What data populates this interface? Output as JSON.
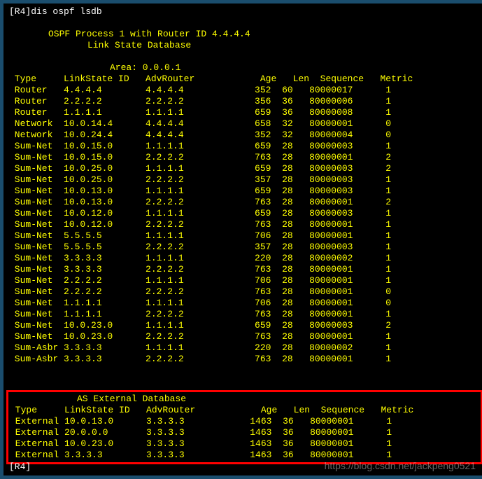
{
  "prompt_prefix": "[R4]",
  "command": "dis ospf lsdb",
  "header1": "OSPF Process 1 with Router ID 4.4.4.4",
  "header2": "Link State Database",
  "area_label": "Area: 0.0.0.1",
  "cols": {
    "type": "Type",
    "lsid": "LinkState ID",
    "advrouter": "AdvRouter",
    "age": "Age",
    "len": "Len",
    "seq": "Sequence",
    "metric": "Metric"
  },
  "lsdb_rows": [
    {
      "type": "Router",
      "lsid": "4.4.4.4",
      "adv": "4.4.4.4",
      "age": "352",
      "len": "60",
      "seq": "80000017",
      "metric": "1"
    },
    {
      "type": "Router",
      "lsid": "2.2.2.2",
      "adv": "2.2.2.2",
      "age": "356",
      "len": "36",
      "seq": "80000006",
      "metric": "1"
    },
    {
      "type": "Router",
      "lsid": "1.1.1.1",
      "adv": "1.1.1.1",
      "age": "659",
      "len": "36",
      "seq": "80000008",
      "metric": "1"
    },
    {
      "type": "Network",
      "lsid": "10.0.14.4",
      "adv": "4.4.4.4",
      "age": "658",
      "len": "32",
      "seq": "80000001",
      "metric": "0"
    },
    {
      "type": "Network",
      "lsid": "10.0.24.4",
      "adv": "4.4.4.4",
      "age": "352",
      "len": "32",
      "seq": "80000004",
      "metric": "0"
    },
    {
      "type": "Sum-Net",
      "lsid": "10.0.15.0",
      "adv": "1.1.1.1",
      "age": "659",
      "len": "28",
      "seq": "80000003",
      "metric": "1"
    },
    {
      "type": "Sum-Net",
      "lsid": "10.0.15.0",
      "adv": "2.2.2.2",
      "age": "763",
      "len": "28",
      "seq": "80000001",
      "metric": "2"
    },
    {
      "type": "Sum-Net",
      "lsid": "10.0.25.0",
      "adv": "1.1.1.1",
      "age": "659",
      "len": "28",
      "seq": "80000003",
      "metric": "2"
    },
    {
      "type": "Sum-Net",
      "lsid": "10.0.25.0",
      "adv": "2.2.2.2",
      "age": "357",
      "len": "28",
      "seq": "80000003",
      "metric": "1"
    },
    {
      "type": "Sum-Net",
      "lsid": "10.0.13.0",
      "adv": "1.1.1.1",
      "age": "659",
      "len": "28",
      "seq": "80000003",
      "metric": "1"
    },
    {
      "type": "Sum-Net",
      "lsid": "10.0.13.0",
      "adv": "2.2.2.2",
      "age": "763",
      "len": "28",
      "seq": "80000001",
      "metric": "2"
    },
    {
      "type": "Sum-Net",
      "lsid": "10.0.12.0",
      "adv": "1.1.1.1",
      "age": "659",
      "len": "28",
      "seq": "80000003",
      "metric": "1"
    },
    {
      "type": "Sum-Net",
      "lsid": "10.0.12.0",
      "adv": "2.2.2.2",
      "age": "763",
      "len": "28",
      "seq": "80000001",
      "metric": "1"
    },
    {
      "type": "Sum-Net",
      "lsid": "5.5.5.5",
      "adv": "1.1.1.1",
      "age": "706",
      "len": "28",
      "seq": "80000001",
      "metric": "1"
    },
    {
      "type": "Sum-Net",
      "lsid": "5.5.5.5",
      "adv": "2.2.2.2",
      "age": "357",
      "len": "28",
      "seq": "80000003",
      "metric": "1"
    },
    {
      "type": "Sum-Net",
      "lsid": "3.3.3.3",
      "adv": "1.1.1.1",
      "age": "220",
      "len": "28",
      "seq": "80000002",
      "metric": "1"
    },
    {
      "type": "Sum-Net",
      "lsid": "3.3.3.3",
      "adv": "2.2.2.2",
      "age": "763",
      "len": "28",
      "seq": "80000001",
      "metric": "1"
    },
    {
      "type": "Sum-Net",
      "lsid": "2.2.2.2",
      "adv": "1.1.1.1",
      "age": "706",
      "len": "28",
      "seq": "80000001",
      "metric": "1"
    },
    {
      "type": "Sum-Net",
      "lsid": "2.2.2.2",
      "adv": "2.2.2.2",
      "age": "763",
      "len": "28",
      "seq": "80000001",
      "metric": "0"
    },
    {
      "type": "Sum-Net",
      "lsid": "1.1.1.1",
      "adv": "1.1.1.1",
      "age": "706",
      "len": "28",
      "seq": "80000001",
      "metric": "0"
    },
    {
      "type": "Sum-Net",
      "lsid": "1.1.1.1",
      "adv": "2.2.2.2",
      "age": "763",
      "len": "28",
      "seq": "80000001",
      "metric": "1"
    },
    {
      "type": "Sum-Net",
      "lsid": "10.0.23.0",
      "adv": "1.1.1.1",
      "age": "659",
      "len": "28",
      "seq": "80000003",
      "metric": "2"
    },
    {
      "type": "Sum-Net",
      "lsid": "10.0.23.0",
      "adv": "2.2.2.2",
      "age": "763",
      "len": "28",
      "seq": "80000001",
      "metric": "1"
    },
    {
      "type": "Sum-Asbr",
      "lsid": "3.3.3.3",
      "adv": "1.1.1.1",
      "age": "220",
      "len": "28",
      "seq": "80000002",
      "metric": "1"
    },
    {
      "type": "Sum-Asbr",
      "lsid": "3.3.3.3",
      "adv": "2.2.2.2",
      "age": "763",
      "len": "28",
      "seq": "80000001",
      "metric": "1"
    }
  ],
  "ext_header": "AS External Database",
  "ext_rows": [
    {
      "type": "External",
      "lsid": "10.0.13.0",
      "adv": "3.3.3.3",
      "age": "1463",
      "len": "36",
      "seq": "80000001",
      "metric": "1"
    },
    {
      "type": "External",
      "lsid": "20.0.0.0",
      "adv": "3.3.3.3",
      "age": "1463",
      "len": "36",
      "seq": "80000001",
      "metric": "1"
    },
    {
      "type": "External",
      "lsid": "10.0.23.0",
      "adv": "3.3.3.3",
      "age": "1463",
      "len": "36",
      "seq": "80000001",
      "metric": "1"
    },
    {
      "type": "External",
      "lsid": "3.3.3.3",
      "adv": "3.3.3.3",
      "age": "1463",
      "len": "36",
      "seq": "80000001",
      "metric": "1"
    }
  ],
  "end_prompt": "[R4]",
  "watermark": "https://blog.csdn.net/jackpeng0521"
}
